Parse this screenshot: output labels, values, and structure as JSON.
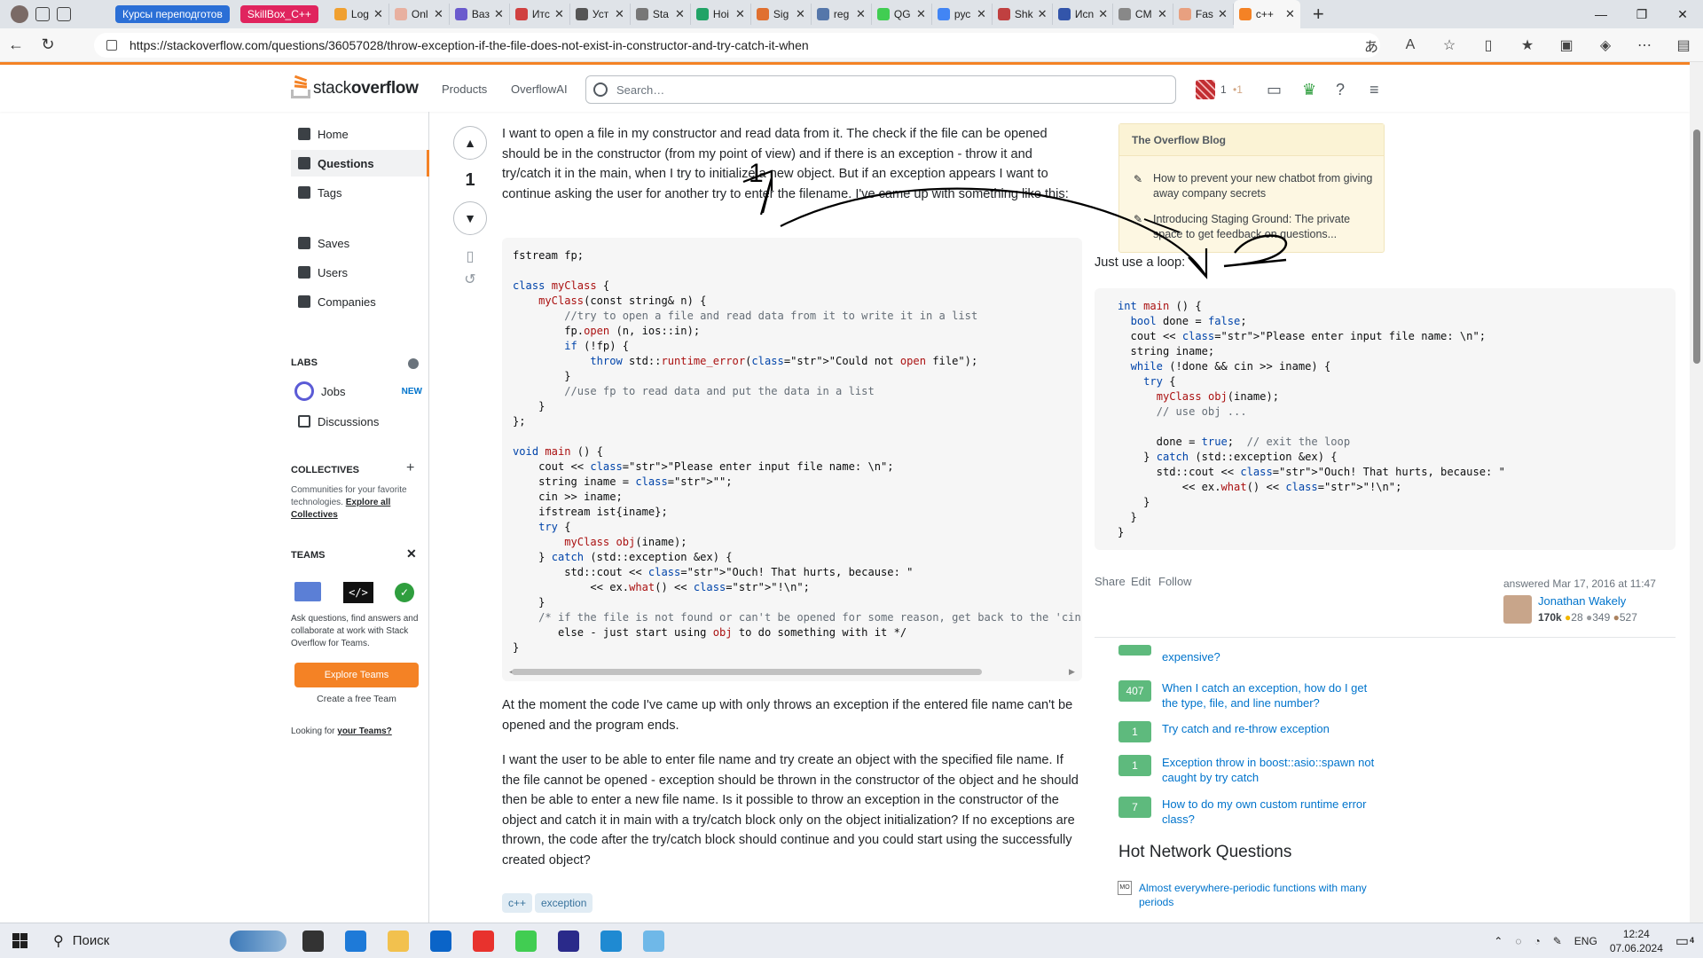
{
  "browser": {
    "group_tabs": [
      "Курсы переподготов",
      "SkillBox_C++"
    ],
    "tabs": [
      {
        "title": "Log",
        "color": "#f0a030"
      },
      {
        "title": "Onl",
        "color": "#e8b0a0"
      },
      {
        "title": "Ваз",
        "color": "#6a5acd"
      },
      {
        "title": "Итс",
        "color": "#d04040"
      },
      {
        "title": "Уст",
        "color": "#555555"
      },
      {
        "title": "Sta",
        "color": "#777777"
      },
      {
        "title": "Ноі",
        "color": "#21a366"
      },
      {
        "title": "Sig",
        "color": "#e07030"
      },
      {
        "title": "reg",
        "color": "#5577aa"
      },
      {
        "title": "QG",
        "color": "#41cd52"
      },
      {
        "title": "рус",
        "color": "#4285f4"
      },
      {
        "title": "Shk",
        "color": "#c04040"
      },
      {
        "title": "Иcn",
        "color": "#3355aa"
      },
      {
        "title": "CM",
        "color": "#888888"
      },
      {
        "title": "Fas",
        "color": "#e8a080"
      },
      {
        "title": "c++",
        "color": "#f48225"
      }
    ],
    "url": "https://stackoverflow.com/questions/36057028/throw-exception-if-the-file-does-not-exist-in-constructor-and-try-catch-it-when"
  },
  "header": {
    "logo_left": "stack",
    "logo_right": "overflow",
    "nav": [
      "Products",
      "OverflowAI"
    ],
    "search_placeholder": "Search…",
    "rep": "1",
    "bronze": "•1"
  },
  "sidebar": {
    "items": [
      "Home",
      "Questions",
      "Tags",
      "Saves",
      "Users",
      "Companies"
    ],
    "labs_heading": "LABS",
    "labs_items": [
      "Jobs",
      "Discussions"
    ],
    "new_badge": "NEW",
    "collectives_heading": "COLLECTIVES",
    "collectives_text": "Communities for your favorite technologies.",
    "collectives_link": "Explore all Collectives",
    "teams_heading": "TEAMS",
    "teams_text": "Ask questions, find answers and collaborate at work with Stack Overflow for Teams.",
    "explore_teams": "Explore Teams",
    "create_team": "Create a free Team",
    "looking_for": "Looking for",
    "your_teams": "your Teams?"
  },
  "question": {
    "vote_count": "1",
    "intro": "I want to open a file in my constructor and read data from it. The check if the file can be opened should be in the constructor (from my point of view) and if there is an exception - throw it and try/catch it in the main, when I try to initialize a new object. But if an exception appears I want to continue asking the user for another try to enter the filename. I've came up with something like this:",
    "code_lines": [
      "fstream fp;",
      "",
      "class myClass {",
      "    myClass(const string& n) {",
      "        //try to open a file and read data from it to write it in a list",
      "        fp.open (n, ios::in);",
      "        if (!fp) {",
      "            throw std::runtime_error(\"Could not open file\");",
      "        }",
      "        //use fp to read data and put the data in a list",
      "    }",
      "};",
      "",
      "void main () {",
      "    cout << \"Please enter input file name: \\n\";",
      "    string iname = \"\";",
      "    cin >> iname;",
      "    ifstream ist{iname};",
      "    try {",
      "        myClass obj(iname);",
      "    } catch (std::exception &ex) {",
      "        std::cout << \"Ouch! That hurts, because: \"",
      "            << ex.what() << \"!\\n\";",
      "    }",
      "    /* if the file is not found or can't be opened for some reason, get back to the 'cin >",
      "       else - just start using obj to do something with it */",
      "}"
    ],
    "para2": "At the moment the code I've came up with only throws an exception if the entered file name can't be opened and the program ends.",
    "para3": "I want the user to be able to enter file name and try create an object with the specified file name. If the file cannot be opened - exception should be thrown in the constructor of the object and he should then be able to enter a new file name. Is it possible to throw an exception in the constructor of the object and catch it in main with a try/catch block only on the object initialization? If no exceptions are thrown, the code after the try/catch block should continue and you could start using the successfully created object?",
    "tags": [
      "c++",
      "exception"
    ]
  },
  "blog": {
    "title": "The Overflow Blog",
    "items": [
      "How to prevent your new chatbot from giving away company secrets",
      "Introducing Staging Ground: The private space to get feedback on questions..."
    ]
  },
  "answer": {
    "lead": "Just use a loop:",
    "code_lines": [
      "int main () {",
      "  bool done = false;",
      "  cout << \"Please enter input file name: \\n\";",
      "  string iname;",
      "  while (!done && cin >> iname) {",
      "    try {",
      "      myClass obj(iname);",
      "      // use obj ...",
      "",
      "      done = true;  // exit the loop",
      "    } catch (std::exception &ex) {",
      "      std::cout << \"Ouch! That hurts, because: \"",
      "          << ex.what() << \"!\\n\";",
      "    }",
      "  }",
      "}"
    ],
    "actions": [
      "Share",
      "Edit",
      "Follow"
    ],
    "answered": "answered Mar 17, 2016 at 11:47",
    "user": "Jonathan Wakely",
    "rep": "170k",
    "gold": "28",
    "silver": "349",
    "bronze": "527"
  },
  "related": [
    {
      "score": "",
      "title": "expensive?"
    },
    {
      "score": "407",
      "title": "When I catch an exception, how do I get the type, file, and line number?"
    },
    {
      "score": "1",
      "title": "Try catch and re-throw exception"
    },
    {
      "score": "1",
      "title": "Exception throw in boost::asio::spawn not caught by try catch"
    },
    {
      "score": "7",
      "title": "How to do my own custom runtime error class?"
    }
  ],
  "hnq": {
    "title": "Hot Network Questions",
    "items": [
      {
        "site": "MO",
        "title": "Almost everywhere-periodic functions with many periods"
      }
    ]
  },
  "annotation": {
    "label1": "1",
    "label2": "2",
    "color": "#000000"
  },
  "taskbar": {
    "search": "Поиск",
    "lang": "ENG",
    "time": "12:24",
    "date": "07.06.2024",
    "notif": "4",
    "apps": [
      {
        "name": "task-view",
        "color": "#333333"
      },
      {
        "name": "edge",
        "color": "#1e7ad8"
      },
      {
        "name": "explorer",
        "color": "#f2c14e"
      },
      {
        "name": "mail",
        "color": "#0a64c8"
      },
      {
        "name": "yandex",
        "color": "#e8322d"
      },
      {
        "name": "qt",
        "color": "#41cd52"
      },
      {
        "name": "app",
        "color": "#2a2a8a"
      },
      {
        "name": "vscode",
        "color": "#1f8ad2"
      },
      {
        "name": "notepad",
        "color": "#6fb8e8"
      }
    ]
  }
}
